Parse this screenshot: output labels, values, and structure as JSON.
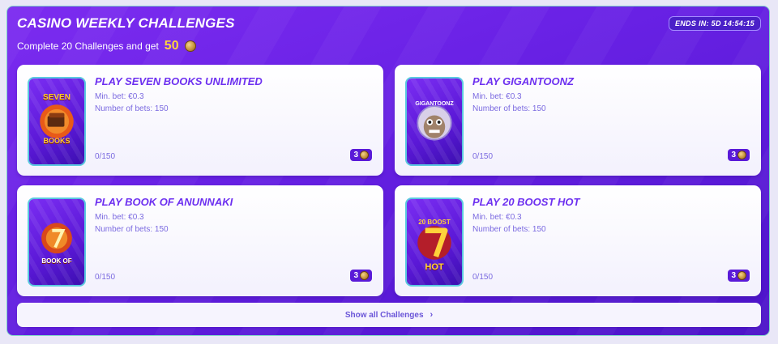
{
  "header": {
    "title": "CASINO WEEKLY CHALLENGES",
    "subtitle": "Complete 20 Challenges and get",
    "reward": "50",
    "timer": "ENDS IN: 5D 14:54:15"
  },
  "challenges": [
    {
      "title": "PLAY SEVEN BOOKS UNLIMITED",
      "min_bet": "Min. bet: €0.3",
      "num_bets": "Number of bets: 150",
      "progress": "0/150",
      "reward": "3",
      "thumb_text": "SEVEN BOOKS unlimited"
    },
    {
      "title": "PLAY GIGANTOONZ",
      "min_bet": "Min. bet: €0.3",
      "num_bets": "Number of bets: 150",
      "progress": "0/150",
      "reward": "3",
      "thumb_text": "GIGANTOONZ"
    },
    {
      "title": "PLAY BOOK OF ANUNNAKI",
      "min_bet": "Min. bet: €0.3",
      "num_bets": "Number of bets: 150",
      "progress": "0/150",
      "reward": "3",
      "thumb_text": "BOOK OF ANUNNAKI"
    },
    {
      "title": "PLAY 20 BOOST HOT",
      "min_bet": "Min. bet: €0.3",
      "num_bets": "Number of bets: 150",
      "progress": "0/150",
      "reward": "3",
      "thumb_text": "20 BOOST 7 HOT"
    }
  ],
  "footer": {
    "show_all": "Show all Challenges"
  },
  "colors": {
    "panel": "#6a22e6",
    "accent_text": "#6d30f0",
    "reward_gold": "#ffd43b"
  }
}
